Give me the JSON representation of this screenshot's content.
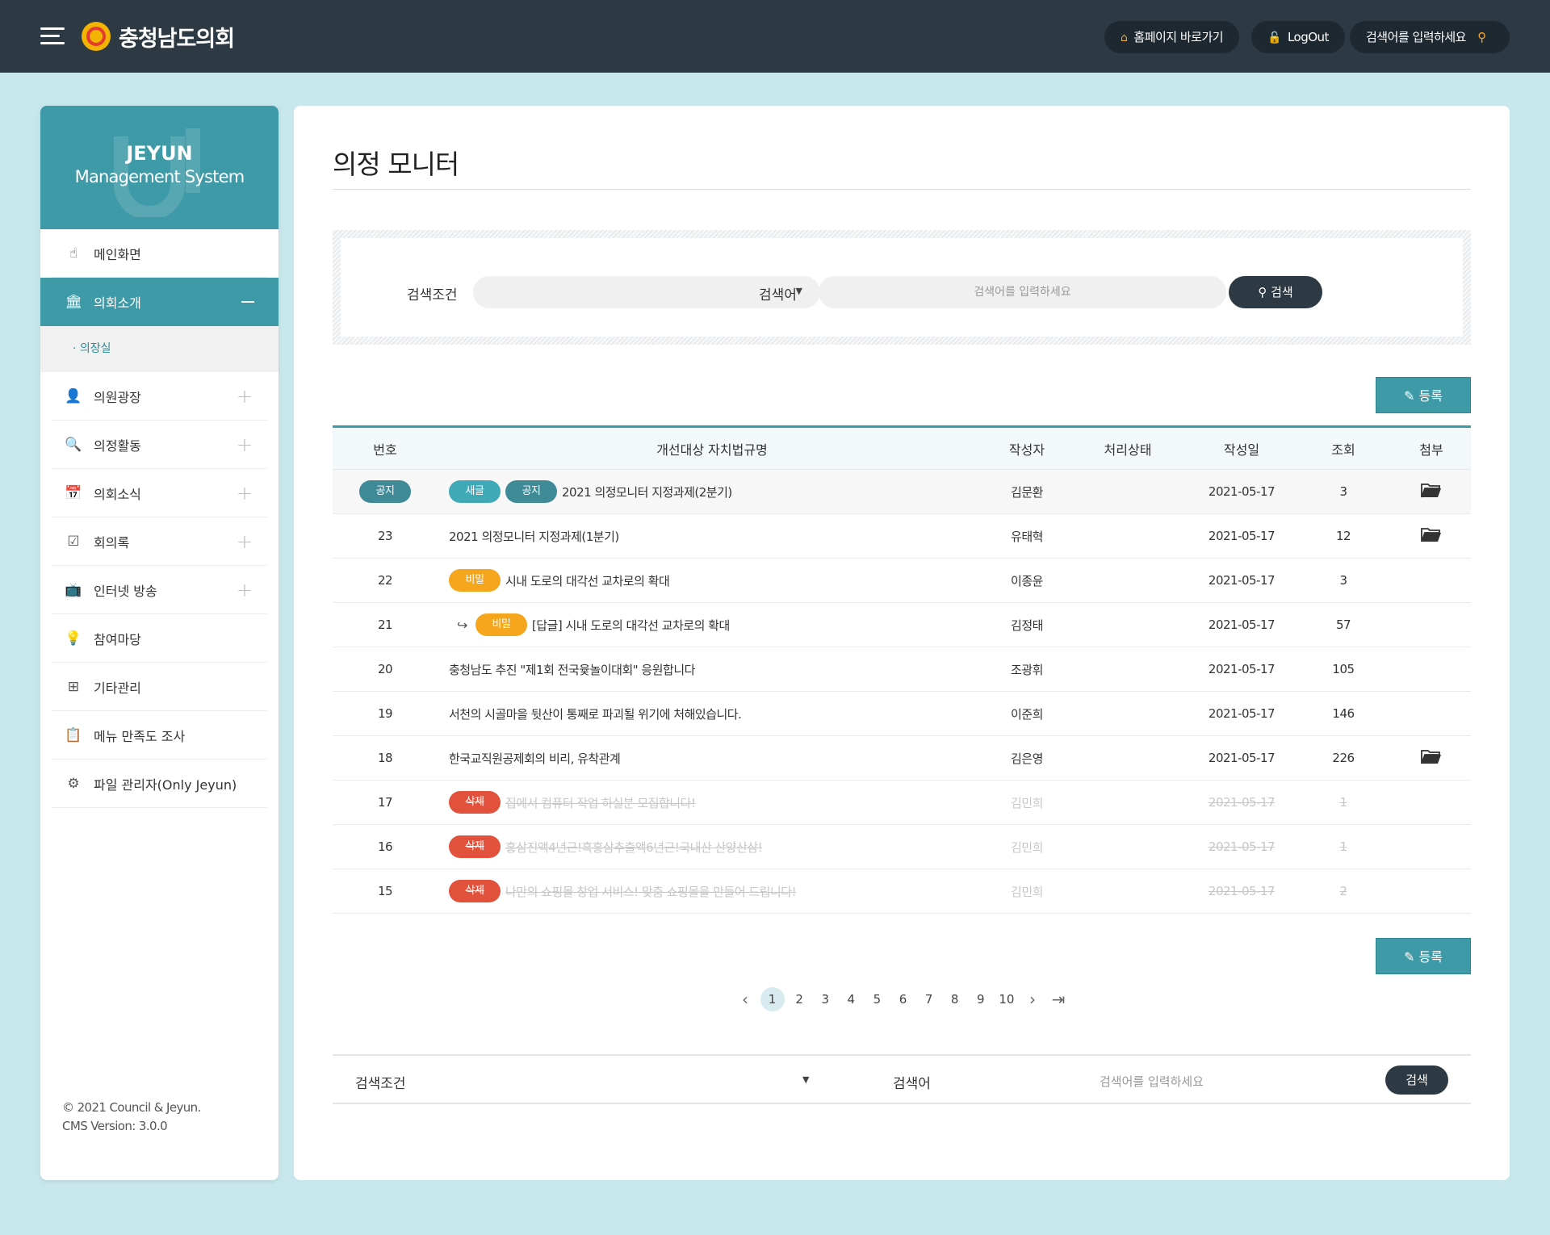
{
  "header": {
    "brand": "충청남도의회",
    "home_link": "홈페이지 바로가기",
    "logout": "LogOut",
    "search_placeholder": "검색어를 입력하세요"
  },
  "sidebar": {
    "title1": "JEYUN",
    "title2": "Management System",
    "items": [
      {
        "label": "메인화면",
        "icon": "pointer-icon"
      },
      {
        "label": "의회소개",
        "icon": "building-icon"
      },
      {
        "label": "의원광장",
        "icon": "person-icon"
      },
      {
        "label": "의정활동",
        "icon": "search-icon"
      },
      {
        "label": "의회소식",
        "icon": "calendar-icon"
      },
      {
        "label": "회의록",
        "icon": "record-icon"
      },
      {
        "label": "인터넷 방송",
        "icon": "broadcast-icon"
      },
      {
        "label": "참여마당",
        "icon": "lightbulb-icon"
      },
      {
        "label": "기타관리",
        "icon": "plus-box-icon"
      },
      {
        "label": "메뉴 만족도 조사",
        "icon": "clipboard-icon"
      },
      {
        "label": "파일 관리자(Only Jeyun)",
        "icon": "file-gear-icon"
      }
    ],
    "sub_item": "· 의장실",
    "footer1": "© 2021 Council & Jeyun.",
    "footer2": "CMS Version: 3.0.0"
  },
  "main": {
    "title": "의정 모니터",
    "search": {
      "cond_label": "검색조건",
      "word_label": "검색어",
      "placeholder": "검색어를 입력하세요",
      "button": "검색"
    },
    "register": "등록",
    "columns": [
      "번호",
      "개선대상 자치법규명",
      "작성자",
      "처리상태",
      "작성일",
      "조회",
      "첨부"
    ],
    "rows": [
      {
        "no": "공지",
        "badges": [
          "새글",
          "공지"
        ],
        "title": "2021 의정모니터 지정과제(2분기)",
        "author": "김문환",
        "status": "",
        "date": "2021-05-17",
        "views": "3",
        "attach": true
      },
      {
        "no": "23",
        "badges": [],
        "title": "2021 의정모니터 지정과제(1분기)",
        "author": "유태혁",
        "status": "",
        "date": "2021-05-17",
        "views": "12",
        "attach": true
      },
      {
        "no": "22",
        "badges": [
          "비밀"
        ],
        "title": "시내 도로의 대각선 교차로의 확대",
        "author": "이종윤",
        "status": "",
        "date": "2021-05-17",
        "views": "3",
        "attach": false
      },
      {
        "no": "21",
        "badges": [
          "비밀"
        ],
        "reply": true,
        "title": "[답글] 시내 도로의 대각선 교차로의 확대",
        "author": "김정태",
        "status": "",
        "date": "2021-05-17",
        "views": "57",
        "attach": false
      },
      {
        "no": "20",
        "badges": [],
        "title": "충청남도 추진 \"제1회 전국윷놀이대회\" 응원합니다",
        "author": "조광휘",
        "status": "",
        "date": "2021-05-17",
        "views": "105",
        "attach": false
      },
      {
        "no": "19",
        "badges": [],
        "title": "서천의 시골마을 뒷산이 통째로 파괴될 위기에 처해있습니다.",
        "author": "이준희",
        "status": "",
        "date": "2021-05-17",
        "views": "146",
        "attach": false
      },
      {
        "no": "18",
        "badges": [],
        "title": "한국교직원공제회의 비리, 유착관계",
        "author": "김은영",
        "status": "",
        "date": "2021-05-17",
        "views": "226",
        "attach": true
      },
      {
        "no": "17",
        "badges": [
          "삭제"
        ],
        "deleted": true,
        "title": "집에서 컴퓨터 작업 하실분 모집합니다!",
        "author": "김민희",
        "status": "",
        "date": "2021-05-17",
        "views": "1",
        "attach": false
      },
      {
        "no": "16",
        "badges": [
          "삭제"
        ],
        "deleted": true,
        "title": "홍삼진액4년근!흑홍삼추출액6년근!국내산 산양산삼!",
        "author": "김민희",
        "status": "",
        "date": "2021-05-17",
        "views": "1",
        "attach": false
      },
      {
        "no": "15",
        "badges": [
          "삭제"
        ],
        "deleted": true,
        "title": "나만의 쇼핑몰 창업 서비스! 맞춤 쇼핑몰을 만들어 드립니다!",
        "author": "김민희",
        "status": "",
        "date": "2021-05-17",
        "views": "2",
        "attach": false
      }
    ],
    "pages": [
      "1",
      "2",
      "3",
      "4",
      "5",
      "6",
      "7",
      "8",
      "9",
      "10"
    ],
    "current_page": "1",
    "bottom": {
      "cond_label": "검색조건",
      "word_label": "검색어",
      "placeholder": "검색어를 입력하세요",
      "button": "검색"
    }
  },
  "colors": {
    "accent": "#3f9aa7",
    "header_bg": "#2e3a43",
    "page_bg": "#c7e7ec",
    "secret": "#f6a61d",
    "deleted": "#e2513c"
  }
}
